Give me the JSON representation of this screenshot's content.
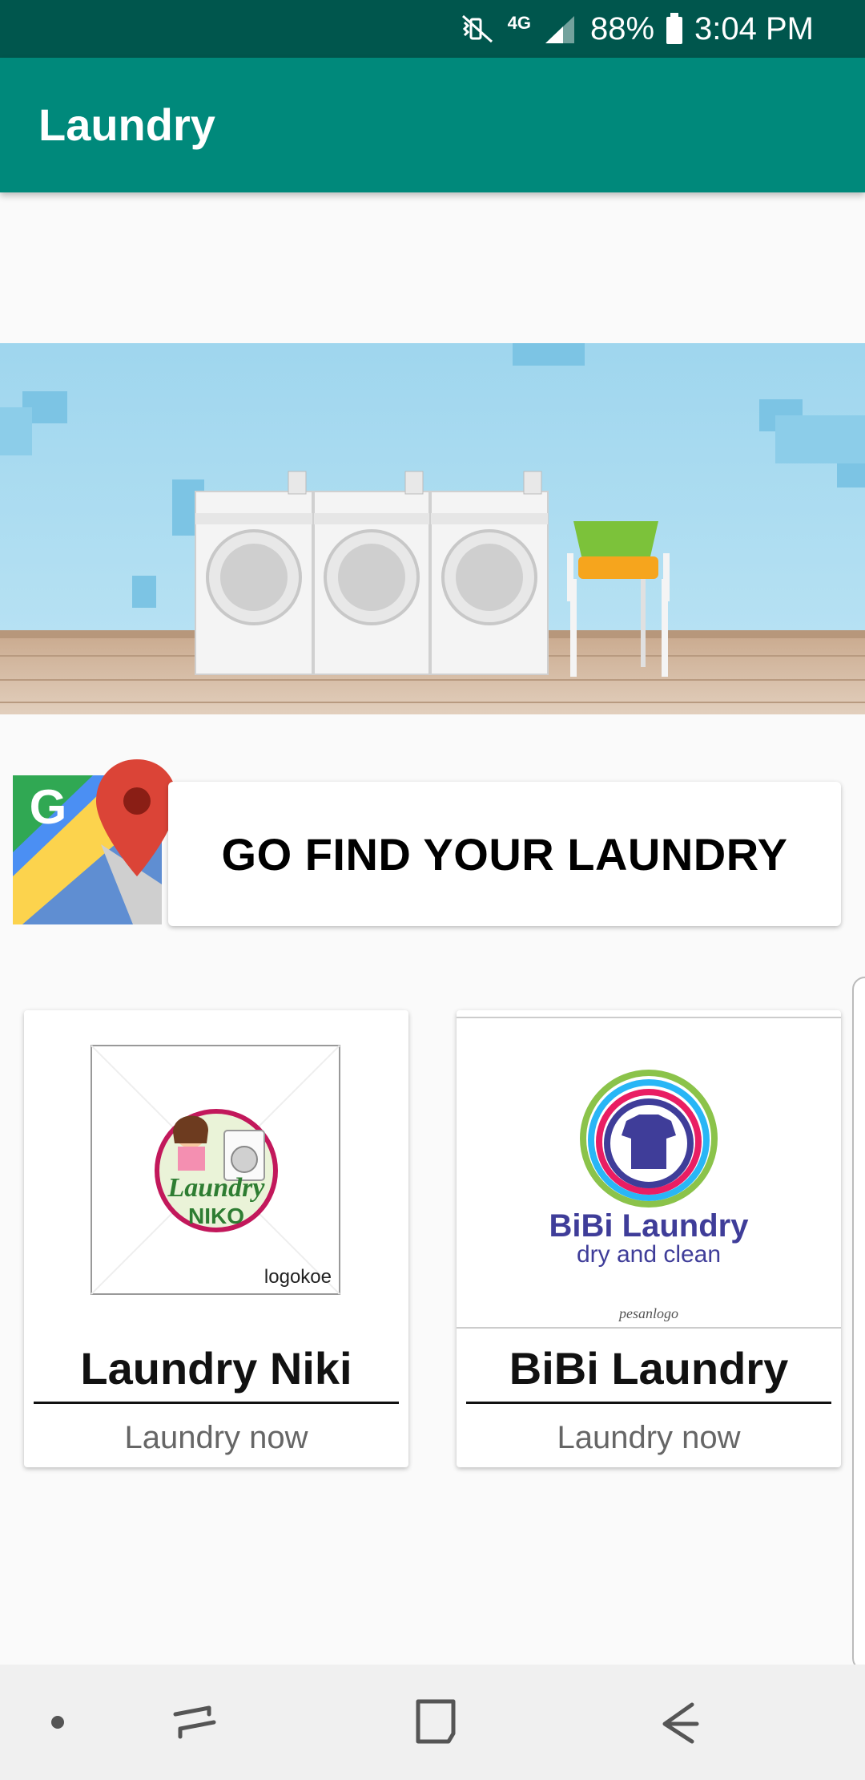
{
  "status_bar": {
    "battery": "88%",
    "time": "3:04 PM",
    "network": "4G",
    "icons": [
      "mute-vibrate-icon",
      "4g-data-icon",
      "signal-icon",
      "battery-icon"
    ]
  },
  "app_bar": {
    "title": "Laundry"
  },
  "hero": {
    "image": "laundry-room-washing-machines-illustration"
  },
  "find_button": {
    "label": "GO FIND YOUR LAUNDRY",
    "icon": "google-maps-icon"
  },
  "laundries": [
    {
      "name": "Laundry Niki",
      "action": "Laundry now",
      "logo": {
        "line1": "Laundry",
        "line2": "NIKO",
        "watermark": "logokoe"
      }
    },
    {
      "name": "BiBi Laundry",
      "action": "Laundry now",
      "logo": {
        "line1": "BiBi Laundry",
        "line2": "dry and clean",
        "watermark": "pesanlogo"
      }
    }
  ],
  "nav_bar": {
    "icons": [
      "dot-icon",
      "recent-apps-icon",
      "home-icon",
      "back-icon"
    ]
  },
  "colors": {
    "status_bar": "#00564d",
    "app_bar": "#00897b",
    "background": "#fafafa"
  }
}
